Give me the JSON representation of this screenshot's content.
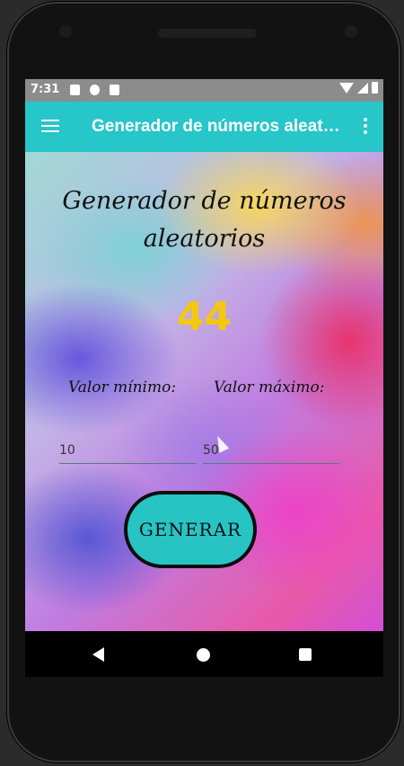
{
  "status_bar": {
    "time": "7:31",
    "icons": [
      "a-icon",
      "circle-notification-icon",
      "sd-card-icon",
      "wifi-icon",
      "signal-icon",
      "battery-icon"
    ]
  },
  "app_bar": {
    "title": "Generador de números aleatorios",
    "menu_icon": "hamburger-menu-icon",
    "overflow_icon": "more-vert-icon",
    "color": "#26c6c9"
  },
  "main": {
    "heading": "Generador de números aleatorios",
    "number": "44",
    "number_color": "#f4c80f",
    "min_label": "Valor mínimo:",
    "max_label": "Valor máximo:",
    "min_value": "10",
    "max_value": "50",
    "button_label": "GENERAR",
    "button_color": "#28c4c4"
  },
  "nav_bar": {
    "back_icon": "back-triangle-icon",
    "home_icon": "home-circle-icon",
    "recents_icon": "recents-square-icon"
  }
}
